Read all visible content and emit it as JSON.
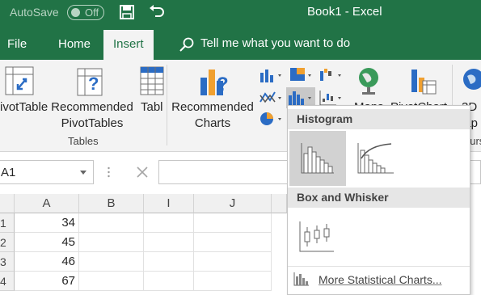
{
  "titlebar": {
    "autosave_label": "AutoSave",
    "autosave_state": "Off",
    "document_title": "Book1  -  Excel",
    "save_icon": "save-icon",
    "undo_icon": "undo-icon"
  },
  "tabs": [
    {
      "label": "File"
    },
    {
      "label": "Home"
    },
    {
      "label": "Insert"
    }
  ],
  "active_tab": "Insert",
  "tell_me": {
    "placeholder": "Tell me what you want to do",
    "icon": "lightbulb-icon"
  },
  "ribbon": {
    "pivottable": "ivotTable",
    "recommended_pivottables_line1": "Recommended",
    "recommended_pivottables_line2": "PivotTables",
    "table": "Tabl",
    "tables_group": "Tables",
    "recommended_charts_line1": "Recommended",
    "recommended_charts_line2": "Charts",
    "maps": "Maps",
    "pivotchart": "PivotChart",
    "map3d_line1": "3D",
    "map3d_line2": "lap",
    "tours_group": "ours"
  },
  "formula_bar": {
    "name_box": "A1",
    "cancel_icon": "close-icon",
    "formula": ""
  },
  "grid": {
    "columns": [
      "A",
      "B",
      "I",
      "J"
    ],
    "rows": [
      {
        "header": "1",
        "A": "34"
      },
      {
        "header": "2",
        "A": "45"
      },
      {
        "header": "3",
        "A": "46"
      },
      {
        "header": "4",
        "A": "67"
      }
    ]
  },
  "dropdown": {
    "histogram_header": "Histogram",
    "histogram_items": [
      "histogram-chart-icon",
      "pareto-chart-icon"
    ],
    "box_whisker_header": "Box and Whisker",
    "box_whisker_items": [
      "box-whisker-chart-icon"
    ],
    "more_label": "More Statistical Charts..."
  },
  "colors": {
    "excel_green": "#217346",
    "ribbon_bg": "#f3f3f3",
    "accent_blue": "#2b6cc4",
    "accent_orange": "#f0a030"
  }
}
